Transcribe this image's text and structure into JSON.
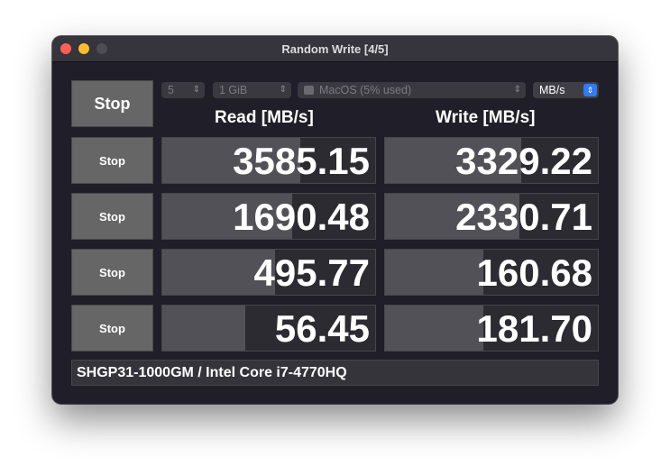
{
  "window": {
    "title": "Random Write [4/5]"
  },
  "controls": {
    "stop_all_label": "Stop",
    "count_value": "5",
    "size_value": "1 GiB",
    "target_value": "MacOS (5% used)",
    "unit_value": "MB/s"
  },
  "headers": {
    "read": "Read [MB/s]",
    "write": "Write [MB/s]"
  },
  "rows": [
    {
      "stop_label": "Stop",
      "read": "3585.15",
      "write": "3329.22",
      "read_fill": 0.65,
      "write_fill": 0.64
    },
    {
      "stop_label": "Stop",
      "read": "1690.48",
      "write": "2330.71",
      "read_fill": 0.61,
      "write_fill": 0.63
    },
    {
      "stop_label": "Stop",
      "read": "495.77",
      "write": "160.68",
      "read_fill": 0.53,
      "write_fill": 0.46
    },
    {
      "stop_label": "Stop",
      "read": "56.45",
      "write": "181.70",
      "read_fill": 0.39,
      "write_fill": 0.46
    }
  ],
  "footer": {
    "info": "SHGP31-1000GM / Intel Core i7-4770HQ"
  },
  "colors": {
    "window_bg": "#201e28",
    "button_bg": "#666666",
    "accent": "#2f7cf6"
  }
}
